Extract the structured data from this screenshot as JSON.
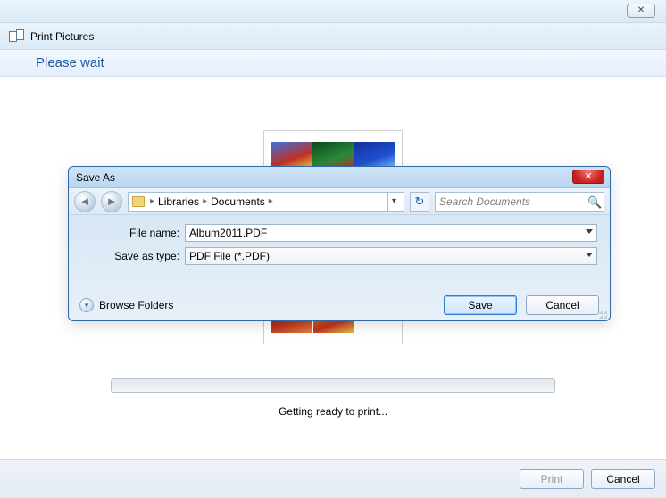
{
  "window": {
    "title": "Print Pictures",
    "please_wait": "Please wait"
  },
  "saveas": {
    "title": "Save As",
    "breadcrumb": {
      "root": "Libraries",
      "folder": "Documents"
    },
    "search_placeholder": "Search Documents",
    "filename_label": "File name:",
    "filename_value": "Album2011.PDF",
    "savetype_label": "Save as type:",
    "savetype_value": "PDF File (*.PDF)",
    "browse_folders": "Browse Folders",
    "save_btn": "Save",
    "cancel_btn": "Cancel"
  },
  "print": {
    "status": "Getting ready to print...",
    "print_btn": "Print",
    "cancel_btn": "Cancel"
  }
}
